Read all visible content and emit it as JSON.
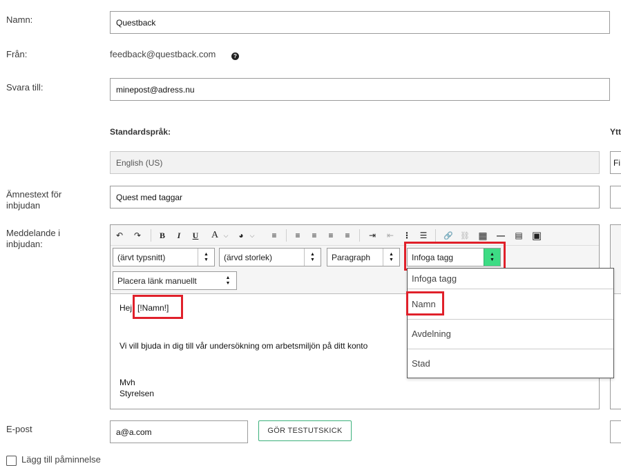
{
  "form": {
    "name_label": "Namn:",
    "name_value": "Questback",
    "from_label": "Från:",
    "from_value": "feedback@questback.com",
    "help_glyph": "?",
    "reply_label": "Svara till:",
    "reply_value": "minepost@adress.nu",
    "default_lang_header": "Standardspråk:",
    "other_lang_header": "Ytt",
    "default_lang_value": "English (US)",
    "other_lang_value": "Fi",
    "subject_label_line1": "Ämnestext för",
    "subject_label_line2": "inbjudan",
    "subject_value": "Quest med taggar",
    "message_label_line1": "Meddelande i",
    "message_label_line2": "inbjudan:",
    "email_label": "E-post",
    "email_value": "a@a.com",
    "test_button": "GÖR TESTUTSKICK",
    "reminder_label": "Lägg till påminnelse"
  },
  "toolbar": {
    "font_select": "(ärvt typsnitt)",
    "size_select": "(ärvd storlek)",
    "format_select": "Paragraph",
    "tag_select": "Infoga tagg",
    "link_select": "Placera länk manuellt",
    "icons": {
      "undo": "↶",
      "redo": "↷",
      "bold": "B",
      "italic": "I",
      "underline": "U",
      "font_color": "A",
      "bg_color": "◕",
      "clear_format": "≡",
      "align_left": "≡",
      "align_center": "≡",
      "align_right": "≡",
      "align_justify": "≡",
      "indent": "⇥",
      "outdent": "⇤",
      "ol": "⋮",
      "ul": "☰",
      "link": "🔗",
      "unlink": "⛓",
      "table": "▦",
      "hr": "—",
      "source": "▤",
      "image": "▣"
    }
  },
  "editor": {
    "greeting": "Hej",
    "name_tag": "[!Namn!]",
    "body": "Vi vill bjuda in dig till vår undersökning om arbetsmiljön på ditt konto",
    "sign_off": "Mvh",
    "signature": "Styrelsen"
  },
  "tag_dropdown": {
    "items": [
      "Infoga tagg",
      "Namn",
      "Avdelning",
      "Stad"
    ]
  },
  "colors": {
    "highlight": "#e0202a",
    "accent_green": "#3ddc84",
    "button_border": "#3ab07a"
  }
}
